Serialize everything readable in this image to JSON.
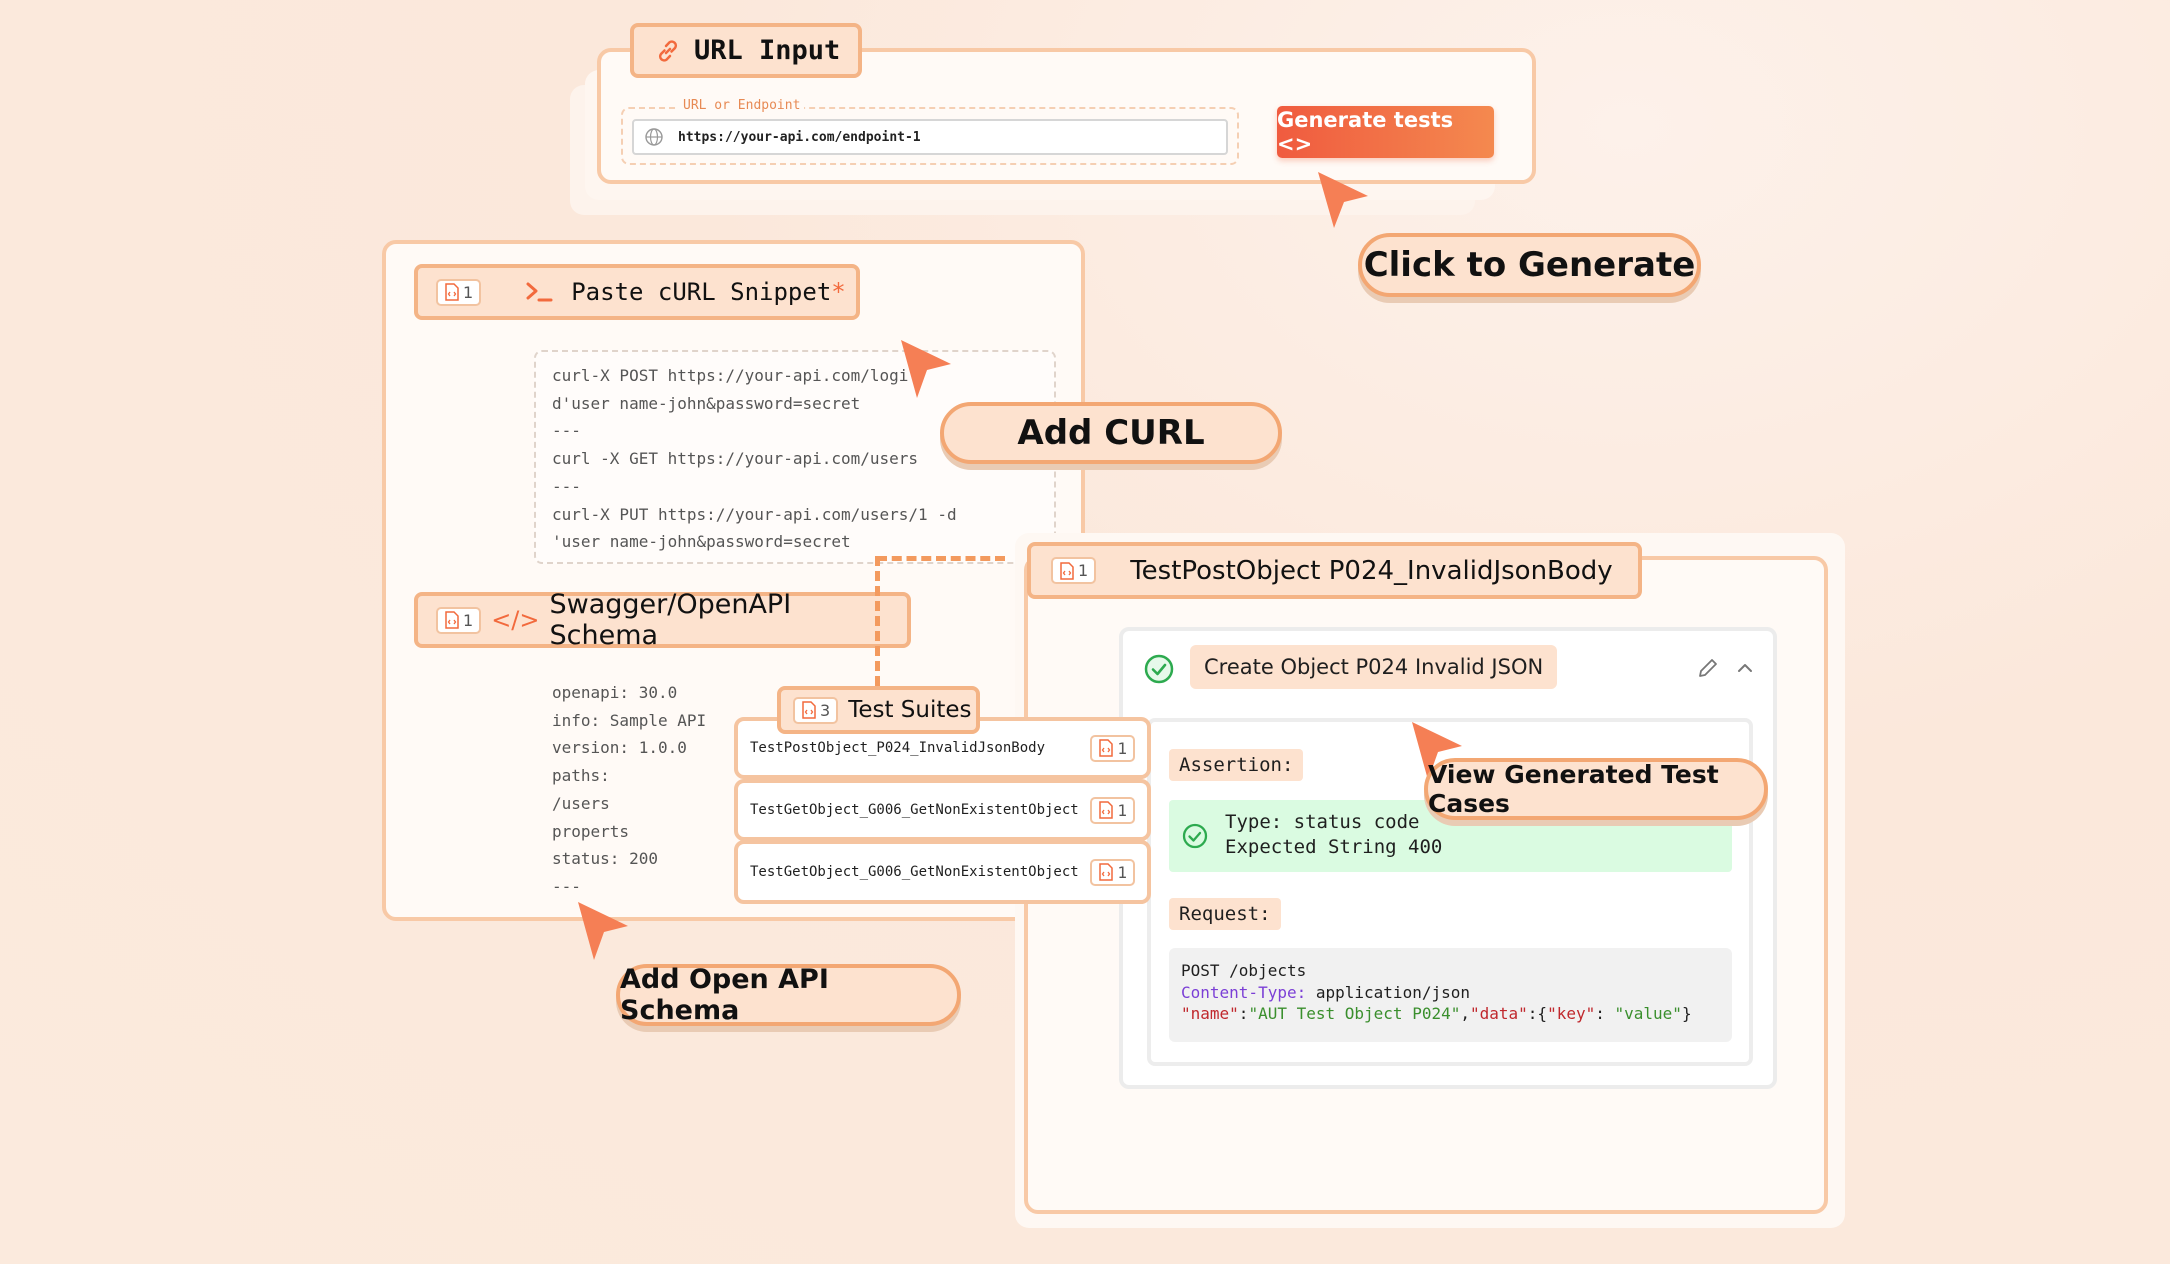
{
  "url_input": {
    "title": "URL Input",
    "field_label": "URL or Endpoint",
    "url_value": "https://your-api.com/endpoint-1",
    "generate_button": "Generate tests <>"
  },
  "callouts": {
    "click_to_generate": "Click to Generate",
    "add_curl": "Add CURL",
    "add_openapi": "Add Open API Schema",
    "view_cases": "View Generated Test Cases"
  },
  "curl_panel": {
    "badge_count": "1",
    "title": "Paste cURL Snippet",
    "required_mark": "*",
    "lines": [
      "curl-X POST https://your-api.com/logi",
      "d'user name-john&password=secret",
      "---",
      "curl -X GET https://your-api.com/users",
      "---",
      "curl-X PUT https://your-api.com/users/1 -d",
      "'user name-john&password=secret"
    ]
  },
  "swagger_panel": {
    "badge_count": "1",
    "title": "Swagger/OpenAPI Schema",
    "icon_text": "</>",
    "lines": [
      "openapi: 30.0",
      "info: Sample API",
      "version: 1.0.0",
      "paths:",
      "/users",
      "properts",
      "status: 200",
      "---"
    ]
  },
  "test_suites": {
    "badge_count": "3",
    "title": "Test Suites",
    "rows": [
      {
        "name": "TestPostObject_P024_InvalidJsonBody",
        "count": "1"
      },
      {
        "name": "TestGetObject_G006_GetNonExistentObject",
        "count": "1"
      },
      {
        "name": "TestGetObject_G006_GetNonExistentObject",
        "count": "1"
      }
    ]
  },
  "test_detail": {
    "badge_count": "1",
    "title": "TestPostObject P024_InvalidJsonBody",
    "case_title": "Create Object P024 Invalid JSON",
    "assertion_label": "Assertion:",
    "assertion_type": "Type: status code",
    "assertion_expected": "Expected String 400",
    "request_label": "Request:",
    "request_line1": "POST /objects",
    "request_header_key": "Content-Type:",
    "request_header_val": " application/json",
    "body": {
      "k1": "\"name\"",
      "c1": ":",
      "v1": "\"AUT Test Object P024\"",
      "c2": ",",
      "k2": "\"data\"",
      "c3": ":{",
      "k3": "\"key\"",
      "c4": ": ",
      "v3": "\"value\"",
      "c5": "}"
    }
  },
  "colors": {
    "accent": "#f26a3d",
    "panel_border": "#f8c9a6",
    "tab_fill": "#fde2cf",
    "success": "#2daa4f",
    "success_bg": "#dafbe1"
  }
}
